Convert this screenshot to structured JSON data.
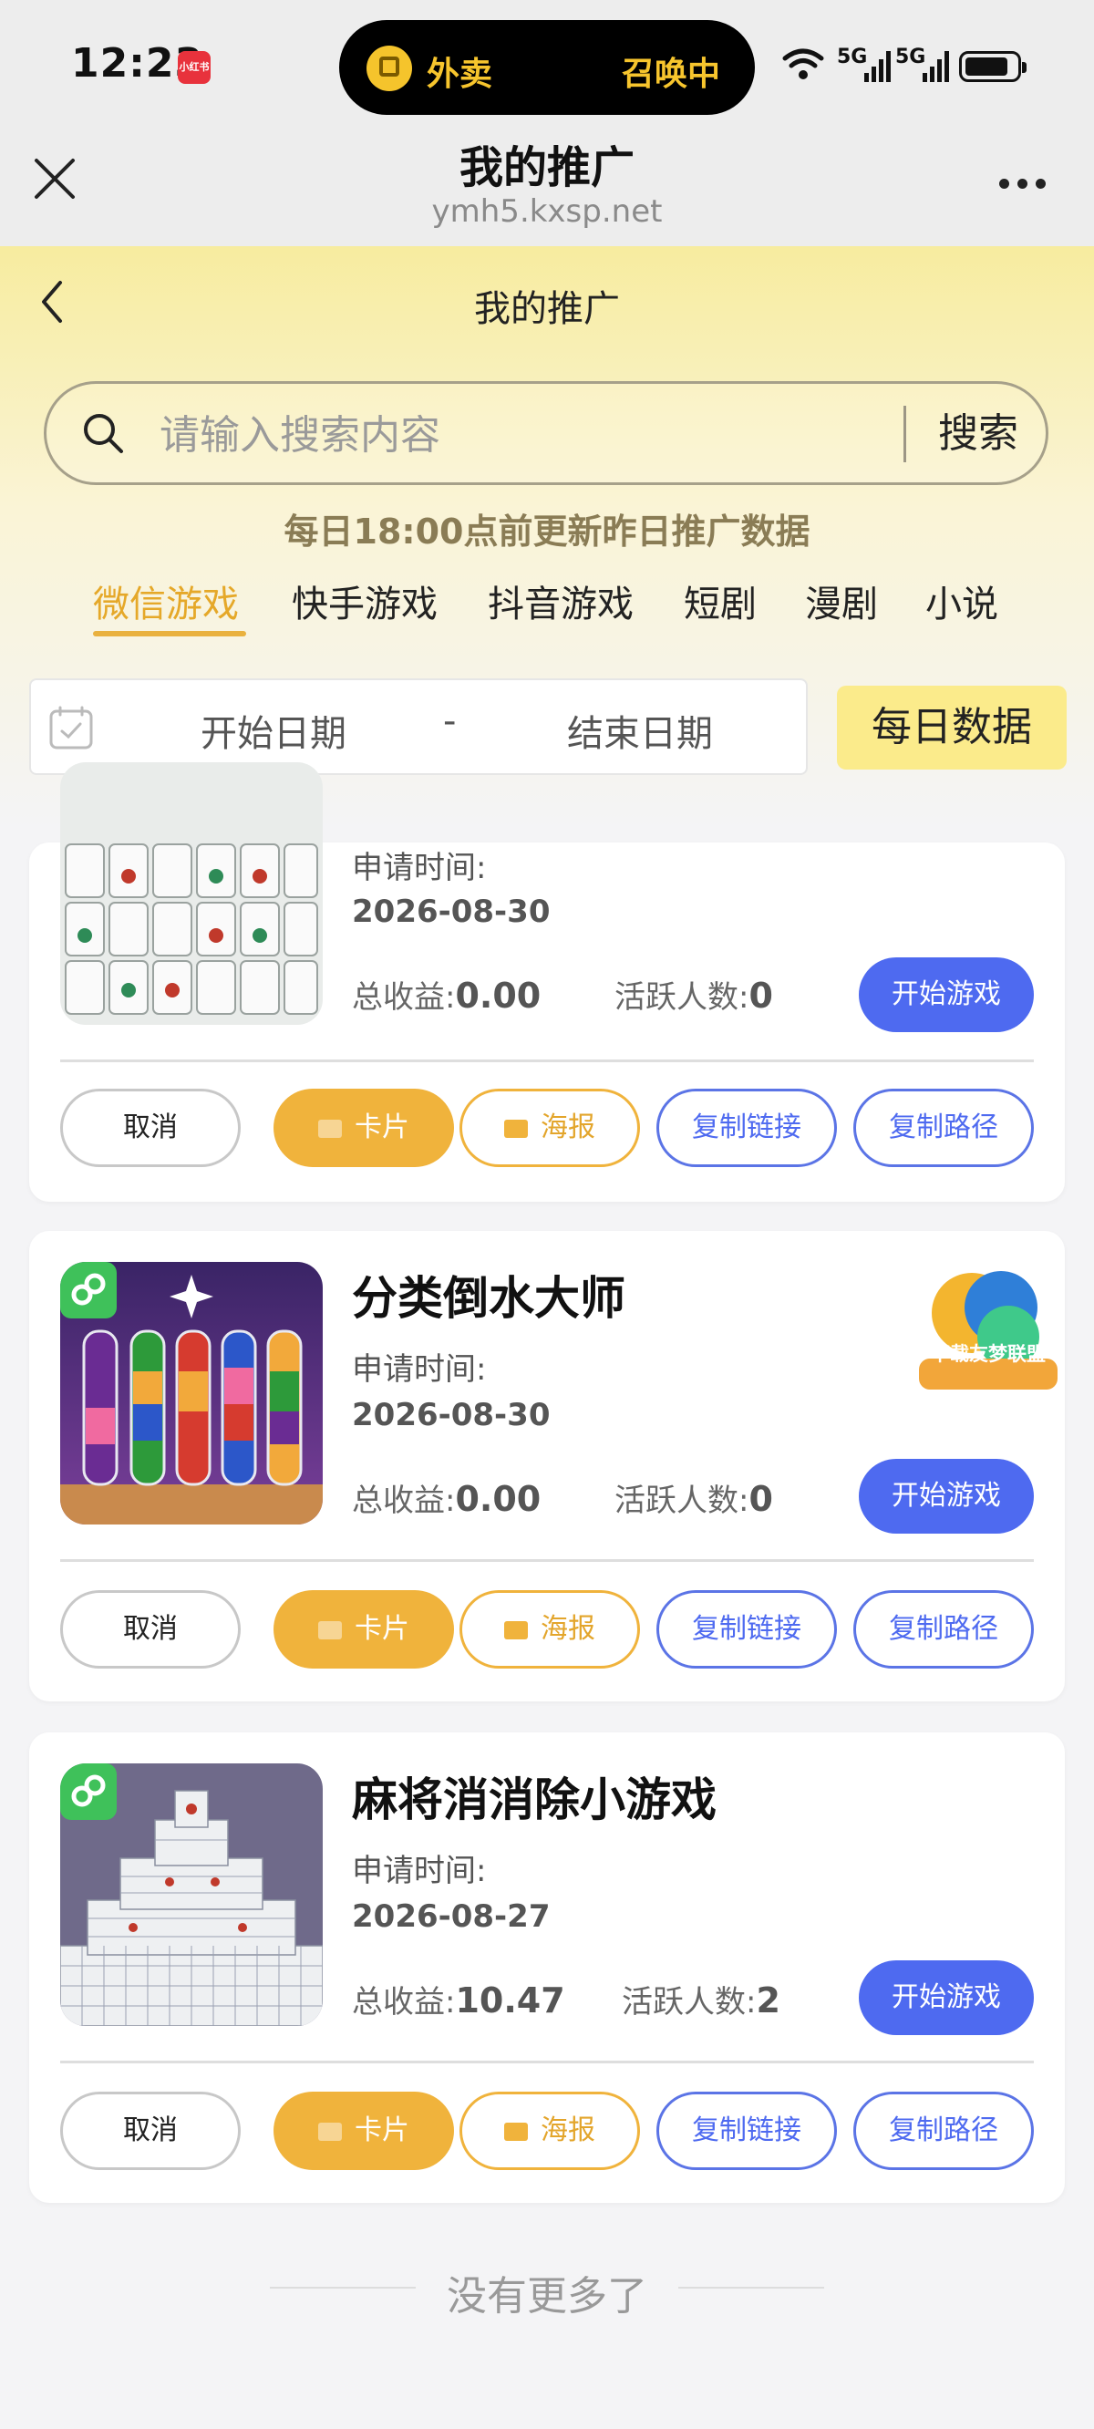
{
  "status_bar": {
    "time": "12:23",
    "app_badge": "小红书",
    "island_left": "外卖",
    "island_right": "召唤中",
    "signal_1": "5G",
    "signal_2": "5G"
  },
  "nav": {
    "title": "我的推广",
    "url": "ymh5.kxsp.net"
  },
  "page": {
    "title": "我的推广",
    "search": {
      "placeholder": "请输入搜索内容",
      "value": "",
      "button": "搜索"
    },
    "notice": "每日18:00点前更新昨日推广数据",
    "tabs": [
      {
        "label": "微信游戏",
        "active": true
      },
      {
        "label": "快手游戏",
        "active": false
      },
      {
        "label": "抖音游戏",
        "active": false
      },
      {
        "label": "短剧",
        "active": false
      },
      {
        "label": "漫剧",
        "active": false
      },
      {
        "label": "小说",
        "active": false
      }
    ],
    "date_start": "开始日期",
    "date_sep": "-",
    "date_end": "结束日期",
    "daily_button": "每日数据"
  },
  "labels": {
    "apply_time": "申请时间:",
    "total_income": "总收益:",
    "active_users": "活跃人数:",
    "play": "开始游戏",
    "cancel": "取消",
    "card": "卡片",
    "poster": "海报",
    "copy_link": "复制链接",
    "copy_path": "复制路径"
  },
  "games": [
    {
      "name": "",
      "apply_date": "2026-08-30",
      "income": "0.00",
      "active": "0",
      "badge": ""
    },
    {
      "name": "分类倒水大师",
      "apply_date": "2026-08-30",
      "income": "0.00",
      "active": "0",
      "badge": "下载友梦联盟"
    },
    {
      "name": "麻将消消除小游戏",
      "apply_date": "2026-08-27",
      "income": "10.47",
      "active": "2",
      "badge": ""
    }
  ],
  "footer": "没有更多了",
  "colors": {
    "accent_blue": "#4e6af0",
    "accent_orange": "#f0b33c",
    "tab_active": "#e5a829",
    "header_yellow": "#f7ec9f"
  }
}
